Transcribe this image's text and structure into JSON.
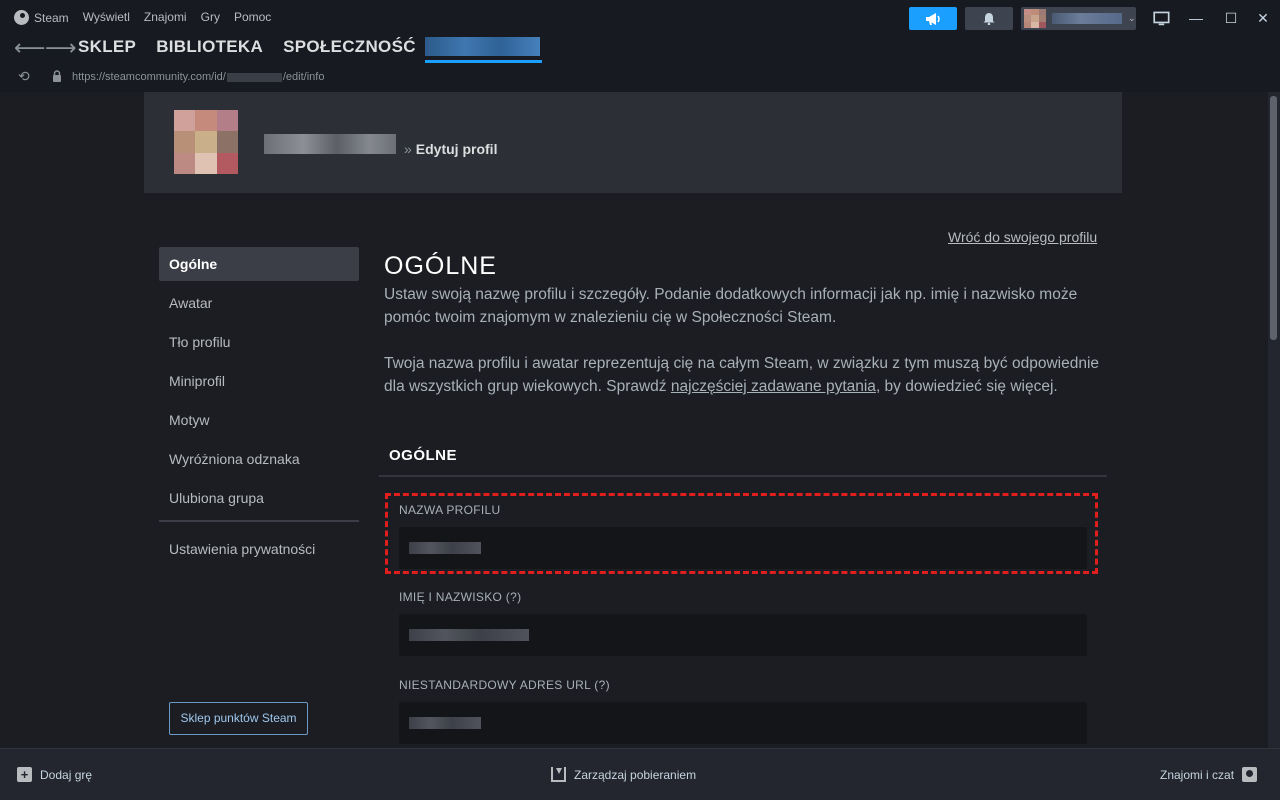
{
  "menu": {
    "items": [
      "Steam",
      "Wyświetl",
      "Znajomi",
      "Gry",
      "Pomoc"
    ]
  },
  "window_controls": {
    "minimize": "—",
    "maximize": "☐",
    "close": "✕"
  },
  "nav": {
    "back": "⟵",
    "forward": "⟶",
    "links": [
      "SKLEP",
      "BIBLIOTEKA",
      "SPOŁECZNOŚĆ"
    ]
  },
  "url": {
    "prefix": "https://steamcommunity.com/id/",
    "suffix": "/edit/info"
  },
  "header": {
    "breadcrumb_sep": "»",
    "breadcrumb_current": "Edytuj profil"
  },
  "sidenav": {
    "items": [
      "Ogólne",
      "Awatar",
      "Tło profilu",
      "Miniprofil",
      "Motyw",
      "Wyróżniona odznaka",
      "Ulubiona grupa"
    ],
    "privacy": "Ustawienia prywatności",
    "points_button": "Sklep punktów Steam"
  },
  "main": {
    "back_link": "Wróć do swojego profilu",
    "title": "OGÓLNE",
    "desc1": "Ustaw swoją nazwę profilu i szczegóły. Podanie dodatkowych informacji jak np. imię i nazwisko może pomóc twoim znajomym w znalezieniu cię w Społeczności Steam.",
    "desc2_a": "Twoja nazwa profilu i awatar reprezentują cię na całym Steam, w związku z tym muszą być odpowiednie dla wszystkich grup wiekowych. Sprawdź ",
    "desc2_link": "najczęściej zadawane pytania",
    "desc2_b": ", by dowiedzieć się więcej.",
    "section": "OGÓLNE",
    "fields": {
      "profile_name": "NAZWA PROFILU",
      "real_name": "IMIĘ I NAZWISKO (?)",
      "custom_url": "NIESTANDARDOWY ADRES URL (?)"
    }
  },
  "bottom": {
    "add_game": "Dodaj grę",
    "downloads": "Zarządzaj pobieraniem",
    "friends": "Znajomi i czat"
  }
}
